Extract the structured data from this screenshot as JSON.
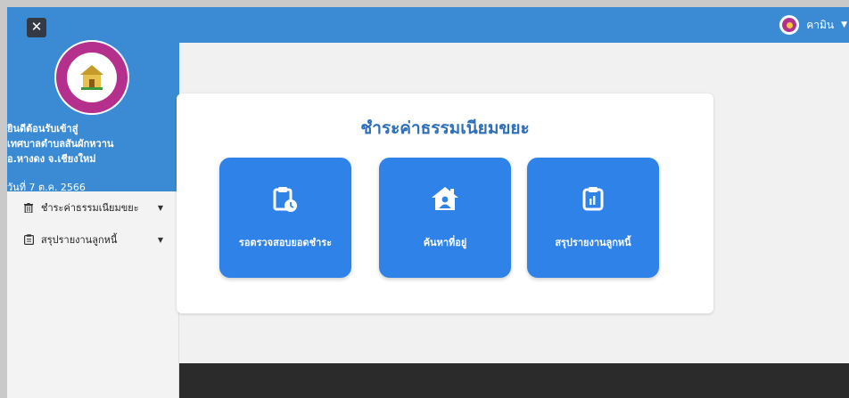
{
  "navbar": {
    "user_name": "คามิน",
    "accent_color": "#3b8bd4"
  },
  "sidebar": {
    "welcome_lines": [
      "ยินดีต้อนรับเข้าสู่",
      "เทศบาลตำบลสันผักหวาน",
      "อ.หางดง จ.เชียงใหม่"
    ],
    "date": "วันที่ 7 ต.ค. 2566",
    "items": [
      {
        "label": "ชำระค่าธรรมเนียมขยะ",
        "icon": "trash-icon"
      },
      {
        "label": "สรุปรายงานลูกหนี้",
        "icon": "clipboard-list-icon"
      }
    ]
  },
  "main": {
    "title": "ชำระค่าธรรมเนียมขยะ",
    "tile_color": "#2e82e8",
    "tiles": [
      {
        "label": "รอตรวจสอบยอดชำระ",
        "icon": "clipboard-clock-icon"
      },
      {
        "label": "ค้นหาที่อยู่",
        "icon": "house-user-icon"
      },
      {
        "label": "สรุปรายงานลูกหนี้",
        "icon": "clipboard-chart-icon"
      }
    ]
  }
}
